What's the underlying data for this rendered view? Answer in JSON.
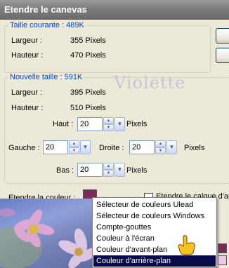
{
  "window": {
    "title": "Etendre le canevas"
  },
  "current_size": {
    "legend": "Taille courante : 489K",
    "width_label": "Largeur :",
    "width_value": "355 Pixels",
    "height_label": "Hauteur :",
    "height_value": "470 Pixels"
  },
  "side_buttons": [
    "",
    ""
  ],
  "new_size": {
    "legend": "Nouvelle taille : 591K",
    "width_label": "Largeur :",
    "width_value": "395 Pixels",
    "height_label": "Hauteur :",
    "height_value": "510 Pixels",
    "top_label": "Haut :",
    "top_value": "20",
    "top_unit": "Pixels",
    "left_label": "Gauche :",
    "left_value": "20",
    "right_label": "Droite :",
    "right_value": "20",
    "right_unit": "Pixels",
    "bottom_label": "Bas :",
    "bottom_value": "20",
    "bottom_unit": "Pixels"
  },
  "watermark": "Violette",
  "extend_color": {
    "label": "Etendre la couleur :",
    "swatch_color": "#7a2a56"
  },
  "checkbox_label": "Etendre le calque d'arrière-plan",
  "color_menu": {
    "items": [
      "Sélecteur de couleurs Ulead",
      "Sélecteur de couleurs Windows",
      "Compte-gouttes",
      "Couleur à l'écran",
      "Couleur d'avant-plan",
      "Couleur d'arrière-plan"
    ],
    "selected_index": 5
  },
  "colors": {
    "titlebar": "#7d7d7d",
    "legend_text": "#0046d5",
    "menu_selected": "#0a0a4a",
    "foreground_swatch": "#7a2a56",
    "background_swatch": "#f3c7e3"
  }
}
